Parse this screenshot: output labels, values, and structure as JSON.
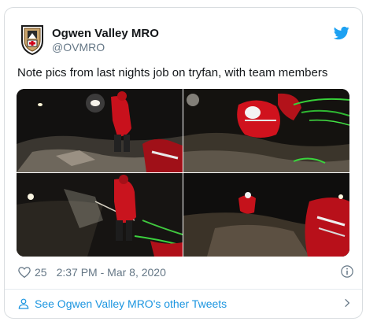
{
  "account": {
    "name": "Ogwen Valley MRO",
    "handle": "@OVMRO",
    "avatar_icon": "mountain-rescue-badge-icon",
    "platform_icon": "twitter-bird-icon",
    "brand_color": "#1da1f2"
  },
  "tweet": {
    "text": "Note pics from last nights job on tryfan, with team members",
    "media": [
      {
        "icon": "photo-rescuers-at-night-1"
      },
      {
        "icon": "photo-rescuers-at-night-2"
      },
      {
        "icon": "photo-rescuers-at-night-3"
      },
      {
        "icon": "photo-rescuers-at-night-4"
      }
    ],
    "likes": "25",
    "timestamp": "2:37 PM - Mar 8, 2020",
    "like_icon": "heart-icon",
    "info_icon": "info-icon"
  },
  "footer": {
    "link_label": "See Ogwen Valley MRO's other Tweets",
    "link_color": "#1b95e0",
    "person_icon": "person-icon",
    "chevron_icon": "chevron-right-icon"
  }
}
